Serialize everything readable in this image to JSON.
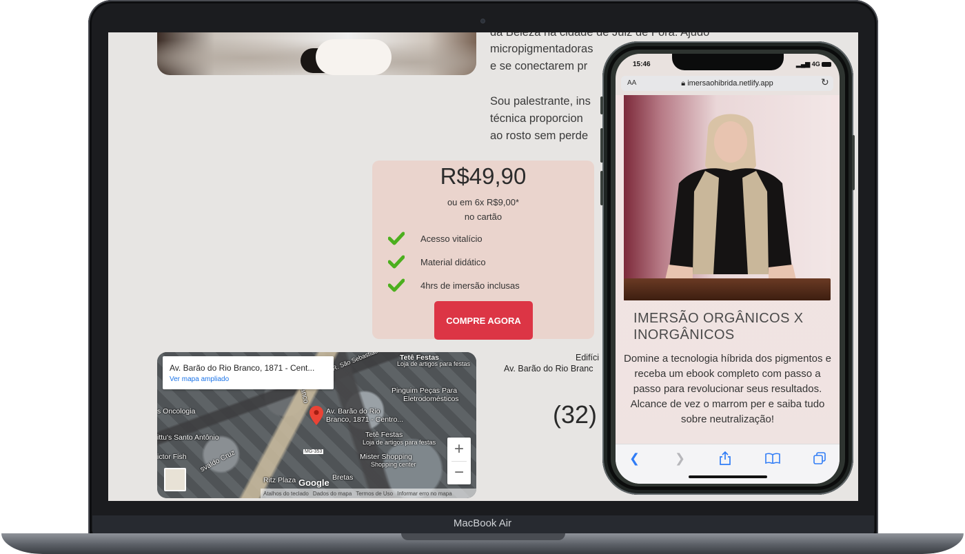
{
  "laptop": {
    "label": "MacBook Air"
  },
  "website": {
    "bio": {
      "lines": [
        "da Beleza na cidade de Juiz de Fora. Ajudo",
        "micropigmentadoras",
        "e se conectarem pr",
        "Sou palestrante, ins",
        "técnica proporcion",
        "ao rosto sem perde"
      ]
    },
    "pricing": {
      "price": "R$49,90",
      "installments_line1": "ou em 6x R$9,00*",
      "installments_line2": "no cartão",
      "features": [
        "Acesso vitalício",
        "Material didático",
        "4hrs de imersão inclusas"
      ],
      "buy_label": "COMPRE AGORA"
    },
    "map": {
      "address": "Av. Barão do Rio Branco, 1871 - Cent...",
      "view_larger": "Ver mapa ampliado",
      "labels": {
        "tete1": "Tetê Festas",
        "tete1_sub": "Loja de artigos para festas",
        "sao_sebastiao": "R. São Sebastião",
        "pinguim": "Pinguim Peças Para",
        "pinguim2": "Eletrodomésticos",
        "oncologia": "s Oncologia",
        "pin_label": "Av. Barão do Rio",
        "pin_label2": "Branco, 1871 - Centro...",
        "tete2": "Tetê Festas",
        "tete2_sub": "Loja de artigos para festas",
        "santo_antonio": "ittu's Santo Antônio",
        "branco": "Branco",
        "mister": "Mister Shopping",
        "mister_sub": "Shopping center",
        "victor": "ictor Fish",
        "osvaldo": "svaldo Cruz",
        "mg": "MG-353",
        "ritz": "Ritz Plaza",
        "bretas": "Bretas"
      },
      "google": "Google",
      "footer": [
        "Atalhos do teclado",
        "Dados do mapa",
        "Termos de Uso",
        "Informar erro no mapa"
      ],
      "zoom_in": "+",
      "zoom_out": "−"
    },
    "address_right": {
      "line1": "Edifíci",
      "line2": "Av. Barão do Rio Branc"
    },
    "phone_partial": "(32)"
  },
  "phone": {
    "time": "15:46",
    "signal": "4G",
    "aa": "AA",
    "url": "imersaohibrida.netlify.app",
    "title": "IMERSÃO ORGÂNICOS X INORGÂNICOS",
    "body": "Domine a tecnologia híbrida dos pigmentos e receba um ebook completo com passo a passo para revolucionar seus resultados. Alcance de vez o marrom per e saiba tudo sobre neutralização!"
  },
  "colors": {
    "accent_red": "#dc3545",
    "check_green": "#4caf1e",
    "card_bg": "#ead4cd",
    "whatsapp": "#25d366",
    "ios_blue": "#2f7cf6"
  }
}
